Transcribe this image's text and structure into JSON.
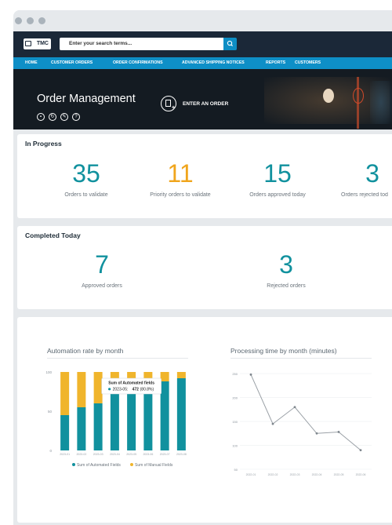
{
  "header": {
    "logo_text": "TMC",
    "search_placeholder": "Enter your search terms..."
  },
  "nav": {
    "items": [
      "HOME",
      "CUSTOMER ORDERS",
      "ORDER CONFIRMATIONS",
      "ADVANCED SHIPPING NOTICES",
      "REPORTS",
      "CUSTOMERS"
    ]
  },
  "banner": {
    "title": "Order Management",
    "enter_order_label": "ENTER AN ORDER"
  },
  "in_progress": {
    "title": "In Progress",
    "stats": [
      {
        "value": "35",
        "label": "Orders to validate",
        "color": "#11919e"
      },
      {
        "value": "11",
        "label": "Priority orders to validate",
        "color": "#f0a51c"
      },
      {
        "value": "15",
        "label": "Orders approved today",
        "color": "#11919e"
      },
      {
        "value": "3",
        "label": "Orders rejected today",
        "color": "#11919e"
      }
    ]
  },
  "completed_today": {
    "title": "Completed Today",
    "stats": [
      {
        "value": "7",
        "label": "Approved orders",
        "color": "#11919e"
      },
      {
        "value": "3",
        "label": "Rejected orders",
        "color": "#11919e"
      }
    ]
  },
  "chart_data": [
    {
      "type": "bar",
      "title": "Automation rate by month",
      "categories": [
        "2023-01",
        "2023-02",
        "2023-03",
        "2023-04",
        "2023-05",
        "2023-06",
        "2023-07",
        "2023-08"
      ],
      "series": [
        {
          "name": "Sum of Automated Fields",
          "values": [
            45,
            55,
            60,
            75,
            80.8,
            85,
            88,
            92
          ],
          "color": "#11919e"
        },
        {
          "name": "Sum of Manual Fields",
          "values": [
            55,
            45,
            40,
            25,
            19.2,
            15,
            12,
            8
          ],
          "color": "#f0b52c"
        }
      ],
      "yticks": [
        0,
        50,
        100
      ],
      "ylim": [
        0,
        100
      ],
      "legend": "bottom",
      "tooltip": {
        "title": "Sum of Automated fields",
        "period": "2023-05:",
        "value": "472",
        "percent": "(80.8%)"
      }
    },
    {
      "type": "line",
      "title": "Processing time by month (minutes)",
      "x": [
        "2022-01",
        "2022-02",
        "2022-03",
        "2022-04",
        "2022-05",
        "2022-06"
      ],
      "series": [
        {
          "values": [
            248,
            145,
            180,
            125,
            128,
            90
          ],
          "color": "#9aa0a6"
        }
      ],
      "yticks": [
        50,
        100,
        150,
        200,
        250
      ],
      "ylim": [
        50,
        260
      ],
      "grid": true
    }
  ]
}
